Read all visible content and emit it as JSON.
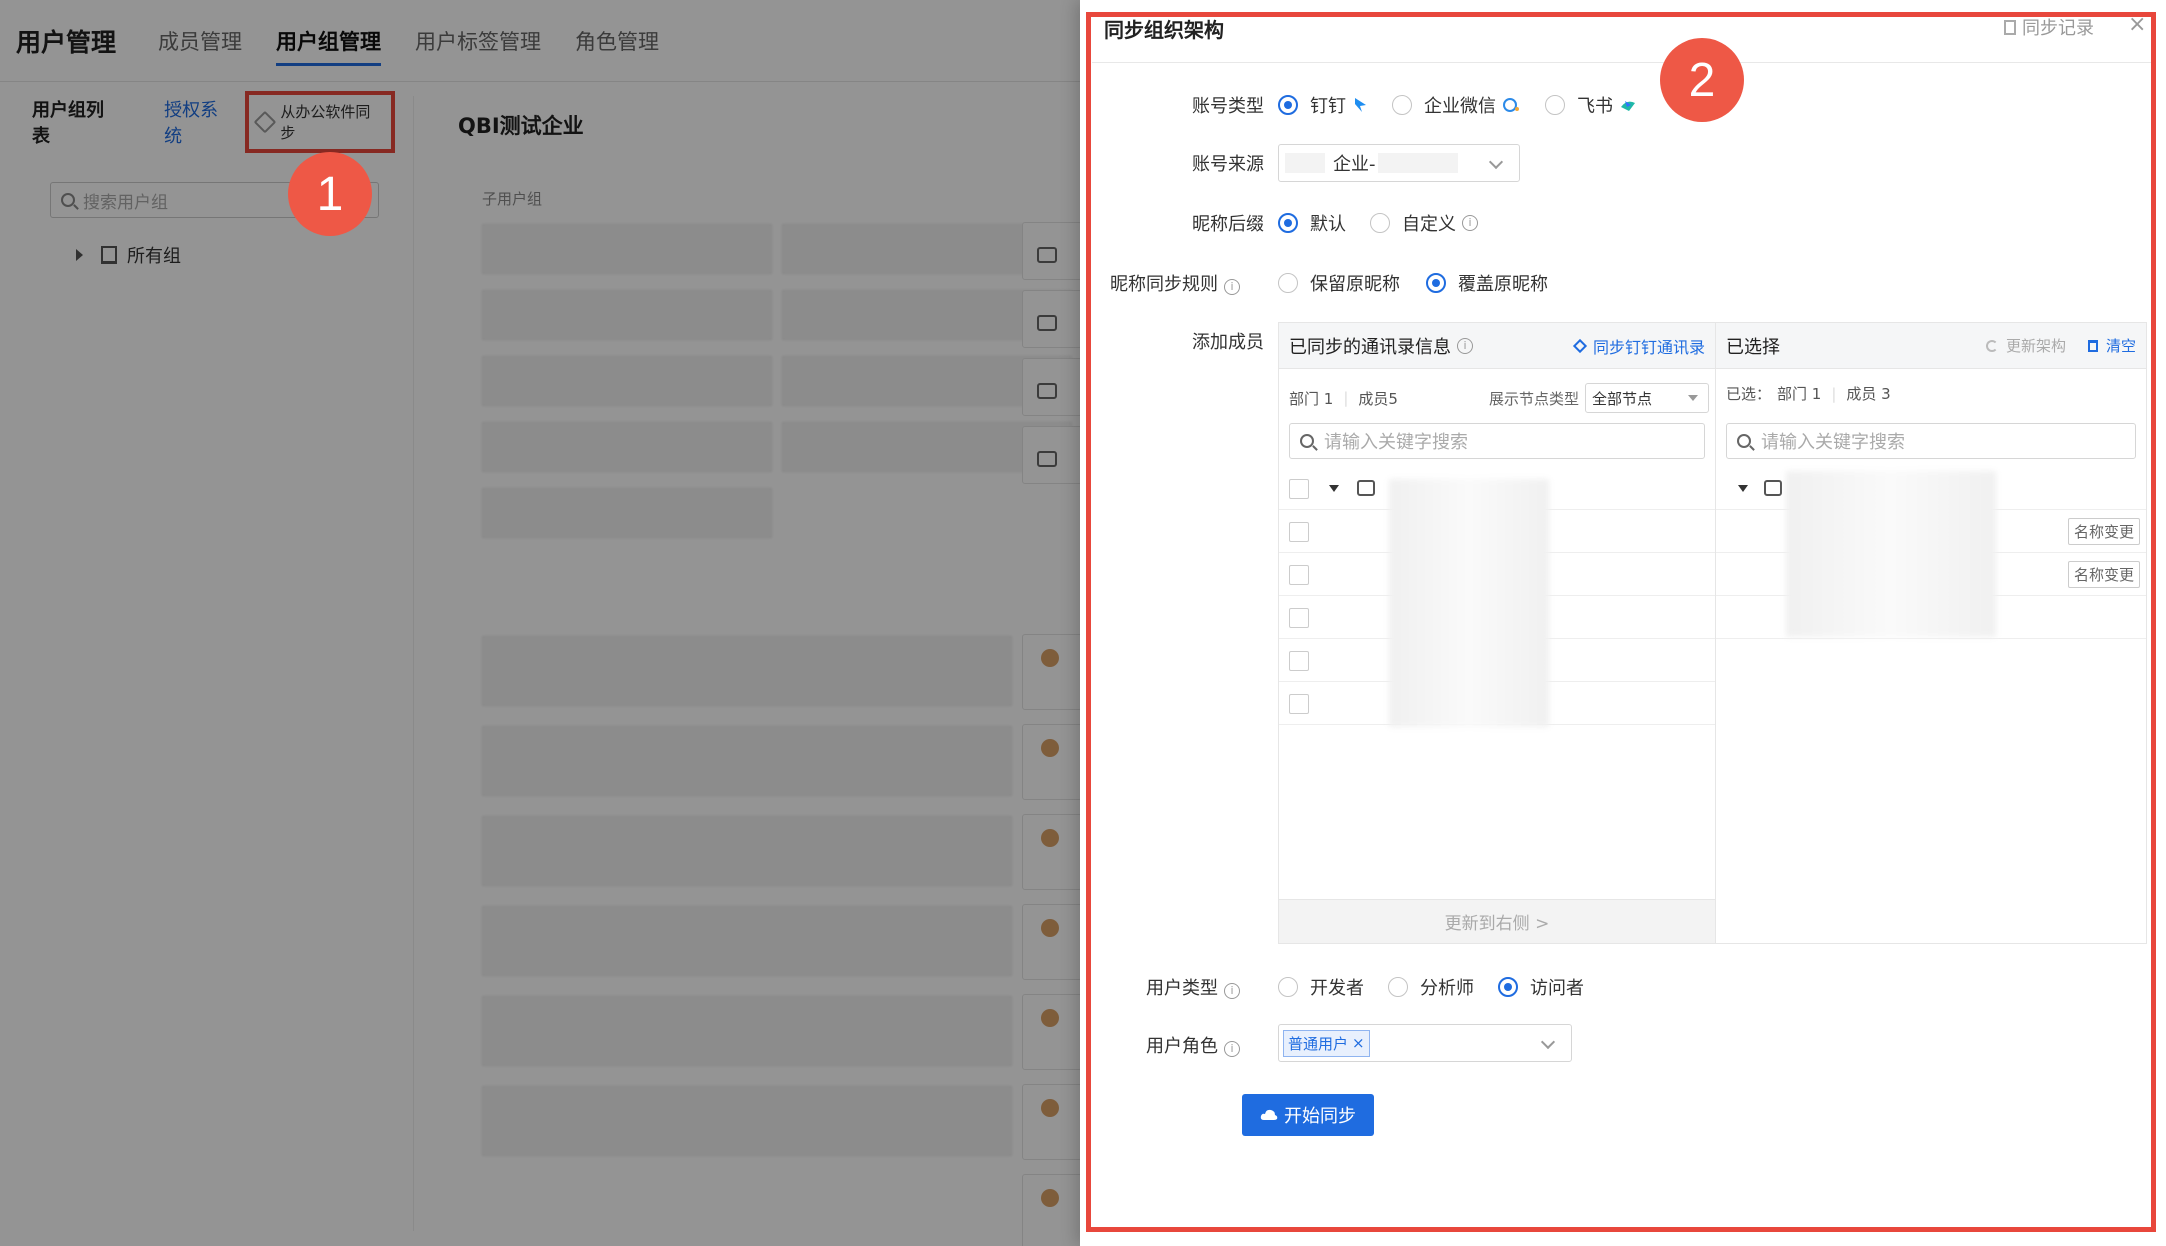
{
  "bg": {
    "brand": "用户管理",
    "tabs": [
      "成员管理",
      "用户组管理",
      "用户标签管理",
      "角色管理"
    ],
    "left": {
      "title": "用户组列表",
      "auth_link": "授权系统",
      "sync_label": "从办公软件同步",
      "search_placeholder": "搜索用户组",
      "tree_root": "所有组"
    },
    "main": {
      "company": "QBI测试企业",
      "subgroup_label": "子用户组"
    }
  },
  "callouts": [
    "1",
    "2"
  ],
  "drawer": {
    "title": "同步组织架构",
    "record_link": "同步记录",
    "close": "×",
    "account_type": {
      "label": "账号类型",
      "options": [
        "钉钉",
        "企业微信",
        "飞书"
      ],
      "selected": 0
    },
    "account_source": {
      "label": "账号来源",
      "value": "企业-"
    },
    "nickname_suffix": {
      "label": "昵称后缀",
      "options": [
        "默认",
        "自定义"
      ],
      "selected": 0
    },
    "nickname_rule": {
      "label": "昵称同步规则",
      "options": [
        "保留原昵称",
        "覆盖原昵称"
      ],
      "selected": 1
    },
    "add_members": {
      "label": "添加成员",
      "left_panel": {
        "title": "已同步的通讯录信息",
        "sync_link": "同步钉钉通讯录",
        "dept": "部门 1",
        "members": "成员5",
        "node_type_label": "展示节点类型",
        "node_type_value": "全部节点",
        "search_placeholder": "请输入关键字搜索",
        "update_btn": "更新到右侧 >"
      },
      "right_panel": {
        "title": "已选择",
        "refresh": "更新架构",
        "clear": "清空",
        "selected_prefix": "已选：",
        "dept": "部门 1",
        "members": "成员 3",
        "search_placeholder": "请输入关键字搜索",
        "rename_tags": [
          "名称变更",
          "名称变更"
        ]
      }
    },
    "user_type": {
      "label": "用户类型",
      "options": [
        "开发者",
        "分析师",
        "访问者"
      ],
      "selected": 2
    },
    "user_role": {
      "label": "用户角色",
      "tag": "普通用户"
    },
    "start_btn": "开始同步"
  },
  "colors": {
    "accent": "#1f6ce0",
    "callout": "#ee5846",
    "frame": "#e8473c"
  }
}
